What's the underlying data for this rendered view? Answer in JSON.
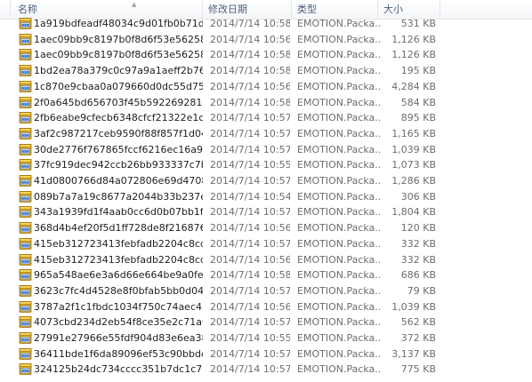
{
  "columns": {
    "name": "名称",
    "date": "修改日期",
    "type": "类型",
    "size": "大小"
  },
  "icon": "package-file-icon",
  "files": [
    {
      "name": "1a919bdfeadf48034c9d01fb0b71d38...",
      "date": "2014/7/14 10:58",
      "type": "EMOTION.Packa...",
      "size": "531 KB"
    },
    {
      "name": "1aec09bb9c8197b0f8d6f53e5625851...",
      "date": "2014/7/14 10:56",
      "type": "EMOTION.Packa...",
      "size": "1,126 KB"
    },
    {
      "name": "1aec09bb9c8197b0f8d6f53e5625851...",
      "date": "2014/7/14 10:58",
      "type": "EMOTION.Packa...",
      "size": "1,126 KB"
    },
    {
      "name": "1bd2ea78a379c0c97a9a1aeff2b76c3f...",
      "date": "2014/7/14 10:58",
      "type": "EMOTION.Packa...",
      "size": "195 KB"
    },
    {
      "name": "1c870e9cbaa0a079660d0dc55d75ea...",
      "date": "2014/7/14 10:56",
      "type": "EMOTION.Packa...",
      "size": "4,284 KB"
    },
    {
      "name": "2f0a645bd656703f45b592269281448...",
      "date": "2014/7/14 10:58",
      "type": "EMOTION.Packa...",
      "size": "584 KB"
    },
    {
      "name": "2fb6eabe9cfecb6348cfcf21322e1c22...",
      "date": "2014/7/14 10:57",
      "type": "EMOTION.Packa...",
      "size": "895 KB"
    },
    {
      "name": "3af2c987217ceb9590f88f857f1d0488...",
      "date": "2014/7/14 10:57",
      "type": "EMOTION.Packa...",
      "size": "1,165 KB"
    },
    {
      "name": "30de2776f767865fccf6216ec16a92e7...",
      "date": "2014/7/14 10:57",
      "type": "EMOTION.Packa...",
      "size": "1,039 KB"
    },
    {
      "name": "37fc919dec942ccb26bb933337c7b08...",
      "date": "2014/7/14 10:55",
      "type": "EMOTION.Packa...",
      "size": "1,073 KB"
    },
    {
      "name": "41d0800766d84a072806e69d470881...",
      "date": "2014/7/14 10:57",
      "type": "EMOTION.Packa...",
      "size": "1,286 KB"
    },
    {
      "name": "089b7a7a19c8677a2044b33b237e6a...",
      "date": "2014/7/14 10:54",
      "type": "EMOTION.Packa...",
      "size": "306 KB"
    },
    {
      "name": "343a1939fd1f4aab0cc6d0b07bb1fe6...",
      "date": "2014/7/14 10:57",
      "type": "EMOTION.Packa...",
      "size": "1,804 KB"
    },
    {
      "name": "368d4b4ef20f5d1ff728de8f216876e7...",
      "date": "2014/7/14 10:56",
      "type": "EMOTION.Packa...",
      "size": "120 KB"
    },
    {
      "name": "415eb312723413febfadb2204c8cda0...",
      "date": "2014/7/14 10:57",
      "type": "EMOTION.Packa...",
      "size": "332 KB"
    },
    {
      "name": "415eb312723413febfadb2204c8cda0...",
      "date": "2014/7/14 10:56",
      "type": "EMOTION.Packa...",
      "size": "332 KB"
    },
    {
      "name": "965a548ae6e3a6d66e664be9a0fe282...",
      "date": "2014/7/14 10:58",
      "type": "EMOTION.Packa...",
      "size": "686 KB"
    },
    {
      "name": "3623c7fc4d4528e8f0bfab5bb0d0424...",
      "date": "2014/7/14 10:57",
      "type": "EMOTION.Packa...",
      "size": "79 KB"
    },
    {
      "name": "3787a2f1c1fbdc1034f750c74aec456e...",
      "date": "2014/7/14 10:56",
      "type": "EMOTION.Packa...",
      "size": "1,039 KB"
    },
    {
      "name": "4073cbd234d2eb54f8ce35e2c71a0e8...",
      "date": "2014/7/14 10:57",
      "type": "EMOTION.Packa...",
      "size": "562 KB"
    },
    {
      "name": "27991e27966e55fdf904d83e6ea3829...",
      "date": "2014/7/14 10:55",
      "type": "EMOTION.Packa...",
      "size": "372 KB"
    },
    {
      "name": "36411bde1f6da89096ef53c90bbde9f...",
      "date": "2014/7/14 10:57",
      "type": "EMOTION.Packa...",
      "size": "3,137 KB"
    },
    {
      "name": "324125b24dc734cccc351b7dc1c7236...",
      "date": "2014/7/14 10:57",
      "type": "EMOTION.Packa...",
      "size": "775 KB"
    }
  ]
}
